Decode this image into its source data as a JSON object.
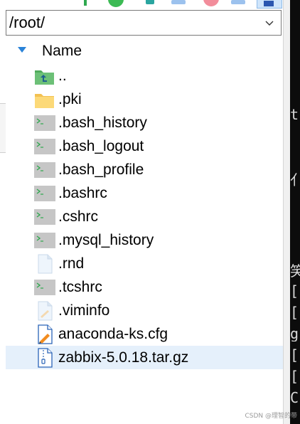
{
  "path": {
    "value": "/root/"
  },
  "list": {
    "header": "Name",
    "items": [
      {
        "name": "..",
        "icon": "parent-folder-icon"
      },
      {
        "name": ".pki",
        "icon": "folder-icon"
      },
      {
        "name": ".bash_history",
        "icon": "shell-script-icon"
      },
      {
        "name": ".bash_logout",
        "icon": "shell-script-icon"
      },
      {
        "name": ".bash_profile",
        "icon": "shell-script-icon"
      },
      {
        "name": ".bashrc",
        "icon": "shell-script-icon"
      },
      {
        "name": ".cshrc",
        "icon": "shell-script-icon"
      },
      {
        "name": ".mysql_history",
        "icon": "shell-script-icon"
      },
      {
        "name": ".rnd",
        "icon": "blank-file-icon"
      },
      {
        "name": ".tcshrc",
        "icon": "shell-script-icon"
      },
      {
        "name": ".viminfo",
        "icon": "edit-file-icon"
      },
      {
        "name": "anaconda-ks.cfg",
        "icon": "config-file-icon"
      },
      {
        "name": "zabbix-5.0.18.tar.gz",
        "icon": "archive-file-icon"
      }
    ],
    "selected_index": 12
  },
  "terminal": {
    "glyphs": [
      "t",
      "",
      "亻",
      "",
      "",
      "笑",
      "[",
      "[",
      "g",
      "[",
      "[",
      "C"
    ]
  },
  "watermark": {
    "text": "CSDN @理智的带"
  },
  "colors": {
    "selection": "#e5f0fb",
    "accent": "#2a83d8",
    "folder": "#fcd978",
    "parent_folder": "#4faa5b"
  }
}
